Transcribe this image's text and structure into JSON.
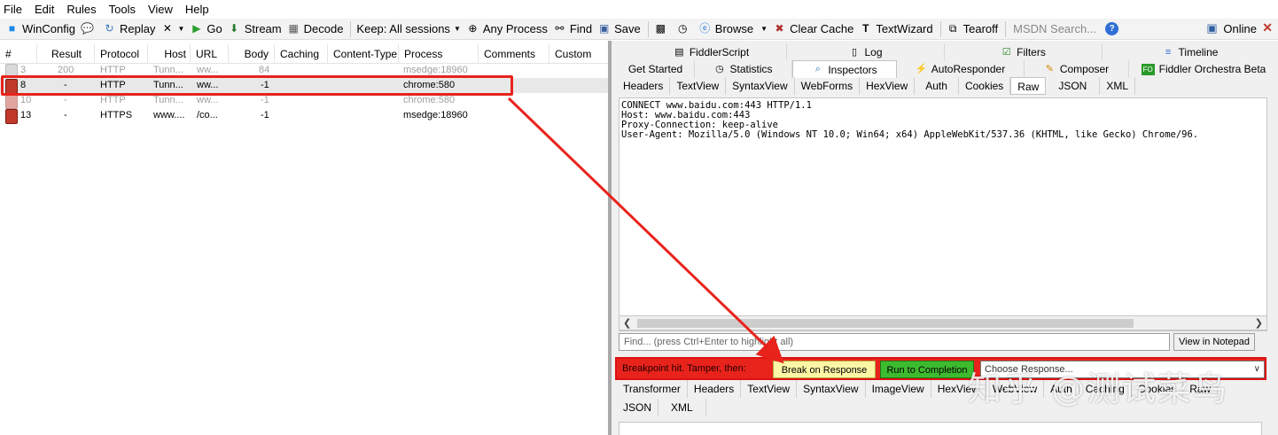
{
  "menu": [
    "File",
    "Edit",
    "Rules",
    "Tools",
    "View",
    "Help"
  ],
  "toolbar": {
    "winconfig": "WinConfig",
    "replay": "Replay",
    "go": "Go",
    "stream": "Stream",
    "decode": "Decode",
    "keep": "Keep: All sessions",
    "any_process": "Any Process",
    "find": "Find",
    "save": "Save",
    "browse": "Browse",
    "clear_cache": "Clear Cache",
    "textwizard": "TextWizard",
    "tearoff": "Tearoff",
    "msdn": "MSDN Search...",
    "online": "Online"
  },
  "grid": {
    "columns": [
      "#",
      "Result",
      "Protocol",
      "Host",
      "URL",
      "Body",
      "Caching",
      "Content-Type",
      "Process",
      "Comments",
      "Custom"
    ],
    "rows": [
      {
        "num": "3",
        "result": "200",
        "protocol": "HTTP",
        "host": "Tunn...",
        "url": "ww...",
        "body": "84",
        "process": "msedge:18960",
        "dim": true
      },
      {
        "num": "8",
        "result": "-",
        "protocol": "HTTP",
        "host": "Tunn...",
        "url": "ww...",
        "body": "-1",
        "process": "chrome:580",
        "dim": false
      },
      {
        "num": "10",
        "result": "-",
        "protocol": "HTTP",
        "host": "Tunn...",
        "url": "ww...",
        "body": "-1",
        "process": "chrome:580",
        "dim": true
      },
      {
        "num": "13",
        "result": "-",
        "protocol": "HTTPS",
        "host": "www....",
        "url": "/co...",
        "body": "-1",
        "process": "msedge:18960",
        "dim": false
      }
    ]
  },
  "tabs_row1": {
    "fiddlerscript": "FiddlerScript",
    "log": "Log",
    "filters": "Filters",
    "timeline": "Timeline"
  },
  "tabs_row2": {
    "get_started": "Get Started",
    "statistics": "Statistics",
    "inspectors": "Inspectors",
    "autoresponder": "AutoResponder",
    "composer": "Composer",
    "orchestra": "Fiddler Orchestra Beta"
  },
  "request_tabs": [
    "Headers",
    "TextView",
    "SyntaxView",
    "WebForms",
    "HexView",
    "Auth",
    "Cookies",
    "Raw",
    "JSON",
    "XML"
  ],
  "raw_text": "CONNECT www.baidu.com:443 HTTP/1.1\nHost: www.baidu.com:443\nProxy-Connection: keep-alive\nUser-Agent: Mozilla/5.0 (Windows NT 10.0; Win64; x64) AppleWebKit/537.36 (KHTML, like Gecko) Chrome/96.",
  "find_placeholder": "Find... (press Ctrl+Enter to highlight all)",
  "view_in_notepad": "View in Notepad",
  "breakpoint": {
    "text": "Breakpoint hit. Tamper, then:",
    "break_on_response": "Break on Response",
    "run_to_completion": "Run to Completion",
    "choose_response": "Choose Response..."
  },
  "response_tabs_row1": [
    "Transformer",
    "Headers",
    "TextView",
    "SyntaxView",
    "ImageView",
    "HexView",
    "WebView",
    "Auth",
    "Caching",
    "Cookies",
    "Raw"
  ],
  "response_tabs_row2": [
    "JSON",
    "XML"
  ],
  "watermark": "知乎 @测试菜鸟",
  "colors": {
    "highlight_red": "#e8231c",
    "yellow_button": "#fdf6a5",
    "green_button": "#3dbb2f"
  }
}
